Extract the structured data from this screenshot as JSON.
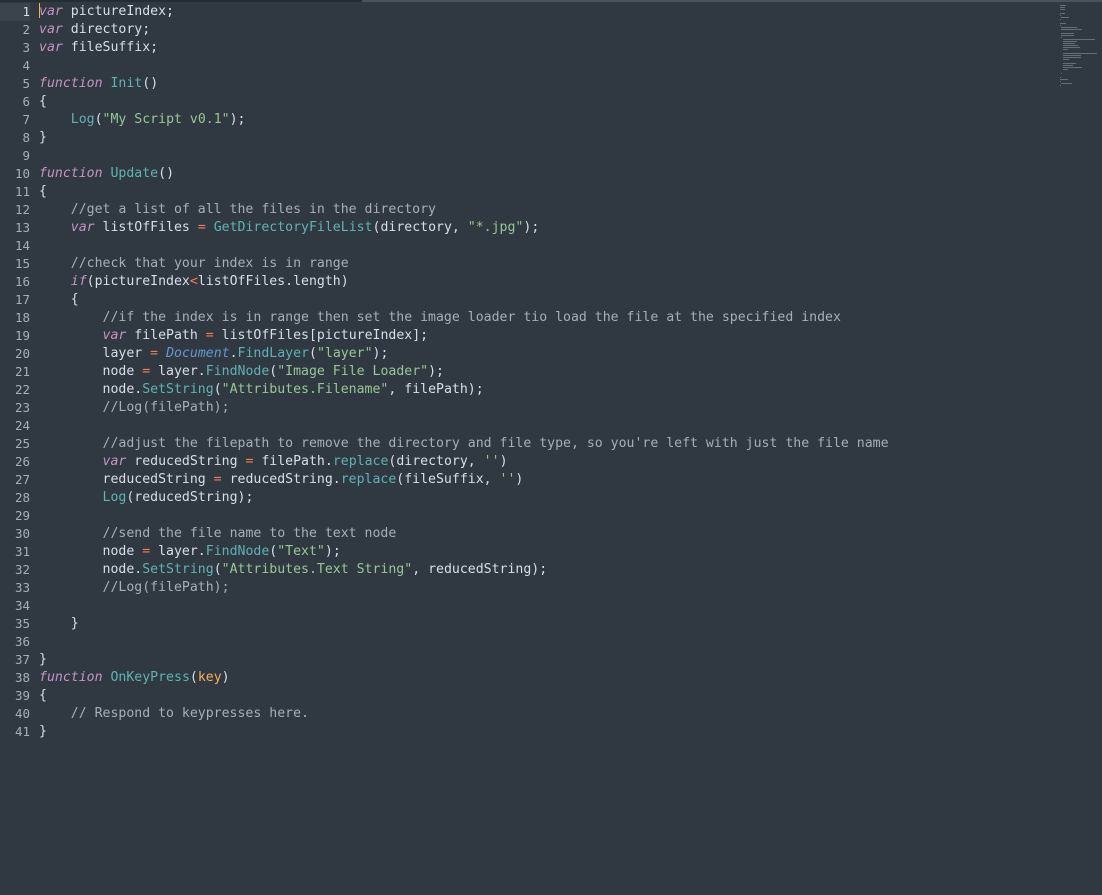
{
  "editor": {
    "active_line": 1,
    "lines": [
      [
        [
          "k",
          "var"
        ],
        [
          "t",
          " pictureIndex;"
        ]
      ],
      [
        [
          "k",
          "var"
        ],
        [
          "t",
          " directory;"
        ]
      ],
      [
        [
          "k",
          "var"
        ],
        [
          "t",
          " fileSuffix;"
        ]
      ],
      [],
      [
        [
          "k",
          "function"
        ],
        [
          "t",
          " "
        ],
        [
          "fn",
          "Init"
        ],
        [
          "t",
          "()"
        ]
      ],
      [
        [
          "t",
          "{"
        ]
      ],
      [
        [
          "t",
          "    "
        ],
        [
          "fn",
          "Log"
        ],
        [
          "t",
          "("
        ],
        [
          "s",
          "\"My Script v0.1\""
        ],
        [
          "t",
          ");"
        ]
      ],
      [
        [
          "t",
          "}"
        ]
      ],
      [],
      [
        [
          "k",
          "function"
        ],
        [
          "t",
          " "
        ],
        [
          "fn",
          "Update"
        ],
        [
          "t",
          "()"
        ]
      ],
      [
        [
          "t",
          "{"
        ]
      ],
      [
        [
          "t",
          "    "
        ],
        [
          "c",
          "//get a list of all the files in the directory"
        ]
      ],
      [
        [
          "t",
          "    "
        ],
        [
          "k",
          "var"
        ],
        [
          "t",
          " listOfFiles "
        ],
        [
          "o",
          "="
        ],
        [
          "t",
          " "
        ],
        [
          "fn",
          "GetDirectoryFileList"
        ],
        [
          "t",
          "(directory, "
        ],
        [
          "s",
          "\"*.jpg\""
        ],
        [
          "t",
          ");"
        ]
      ],
      [],
      [
        [
          "t",
          "    "
        ],
        [
          "c",
          "//check that your index is in range"
        ]
      ],
      [
        [
          "t",
          "    "
        ],
        [
          "k",
          "if"
        ],
        [
          "t",
          "(pictureIndex"
        ],
        [
          "o",
          "<"
        ],
        [
          "t",
          "listOfFiles.length)"
        ]
      ],
      [
        [
          "t",
          "    {"
        ]
      ],
      [
        [
          "t",
          "        "
        ],
        [
          "c",
          "//if the index is in range then set the image loader tio load the file at the specified index"
        ]
      ],
      [
        [
          "t",
          "        "
        ],
        [
          "k",
          "var"
        ],
        [
          "t",
          " filePath "
        ],
        [
          "o",
          "="
        ],
        [
          "t",
          " listOfFiles[pictureIndex];"
        ]
      ],
      [
        [
          "t",
          "        layer "
        ],
        [
          "o",
          "="
        ],
        [
          "t",
          " "
        ],
        [
          "d",
          "Document"
        ],
        [
          "t",
          "."
        ],
        [
          "fn",
          "FindLayer"
        ],
        [
          "t",
          "("
        ],
        [
          "s",
          "\"layer\""
        ],
        [
          "t",
          ");"
        ]
      ],
      [
        [
          "t",
          "        node "
        ],
        [
          "o",
          "="
        ],
        [
          "t",
          " layer."
        ],
        [
          "fn",
          "FindNode"
        ],
        [
          "t",
          "("
        ],
        [
          "s",
          "\"Image File Loader\""
        ],
        [
          "t",
          ");"
        ]
      ],
      [
        [
          "t",
          "        node."
        ],
        [
          "fn",
          "SetString"
        ],
        [
          "t",
          "("
        ],
        [
          "s",
          "\"Attributes.Filename\""
        ],
        [
          "t",
          ", filePath);"
        ]
      ],
      [
        [
          "t",
          "        "
        ],
        [
          "c",
          "//Log(filePath);"
        ]
      ],
      [],
      [
        [
          "t",
          "        "
        ],
        [
          "c",
          "//adjust the filepath to remove the directory and file type, so you're left with just the file name"
        ]
      ],
      [
        [
          "t",
          "        "
        ],
        [
          "k",
          "var"
        ],
        [
          "t",
          " reducedString "
        ],
        [
          "o",
          "="
        ],
        [
          "t",
          " filePath."
        ],
        [
          "fn",
          "replace"
        ],
        [
          "t",
          "(directory, "
        ],
        [
          "s",
          "''"
        ],
        [
          "t",
          ")"
        ]
      ],
      [
        [
          "t",
          "        reducedString "
        ],
        [
          "o",
          "="
        ],
        [
          "t",
          " reducedString."
        ],
        [
          "fn",
          "replace"
        ],
        [
          "t",
          "(fileSuffix, "
        ],
        [
          "s",
          "''"
        ],
        [
          "t",
          ")"
        ]
      ],
      [
        [
          "t",
          "        "
        ],
        [
          "fn",
          "Log"
        ],
        [
          "t",
          "(reducedString);"
        ]
      ],
      [],
      [
        [
          "t",
          "        "
        ],
        [
          "c",
          "//send the file name to the text node"
        ]
      ],
      [
        [
          "t",
          "        node "
        ],
        [
          "o",
          "="
        ],
        [
          "t",
          " layer."
        ],
        [
          "fn",
          "FindNode"
        ],
        [
          "t",
          "("
        ],
        [
          "s",
          "\"Text\""
        ],
        [
          "t",
          ");"
        ]
      ],
      [
        [
          "t",
          "        node."
        ],
        [
          "fn",
          "SetString"
        ],
        [
          "t",
          "("
        ],
        [
          "s",
          "\"Attributes.Text String\""
        ],
        [
          "t",
          ", reducedString);"
        ]
      ],
      [
        [
          "t",
          "        "
        ],
        [
          "c",
          "//Log(filePath);"
        ]
      ],
      [],
      [
        [
          "t",
          "    }"
        ]
      ],
      [],
      [
        [
          "t",
          "}"
        ]
      ],
      [
        [
          "k",
          "function"
        ],
        [
          "t",
          " "
        ],
        [
          "fn",
          "OnKeyPress"
        ],
        [
          "t",
          "("
        ],
        [
          "p",
          "key"
        ],
        [
          "t",
          ")"
        ]
      ],
      [
        [
          "t",
          "{"
        ]
      ],
      [
        [
          "t",
          "    "
        ],
        [
          "c",
          "// Respond to keypresses here."
        ]
      ],
      [
        [
          "t",
          "}"
        ]
      ]
    ]
  },
  "colors": {
    "background": "#303841",
    "keyword": "#c594c5",
    "function": "#5fb3b3",
    "string": "#99c794",
    "comment": "#a7adba",
    "operator": "#f97b58",
    "builtin_object": "#6699cc",
    "parameter": "#f9ae58"
  }
}
